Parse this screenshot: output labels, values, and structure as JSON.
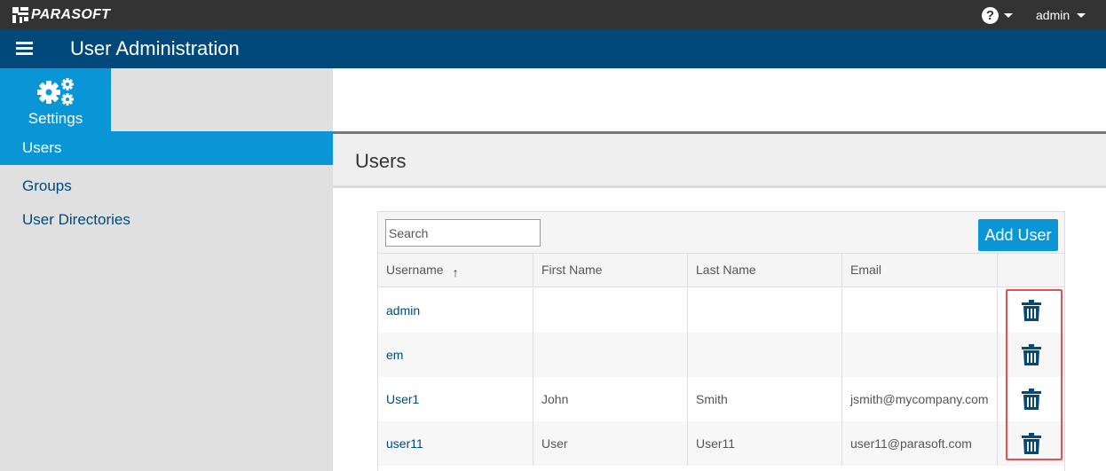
{
  "topbar": {
    "logo_text": "PARASOFT",
    "help_icon": "question-circle-icon",
    "user_name": "admin"
  },
  "titlebar": {
    "menu_icon": "hamburger-icon",
    "title": "User Administration"
  },
  "sidebar": {
    "settings_icon": "gears-icon",
    "settings_label": "Settings",
    "items": [
      {
        "label": "Users",
        "active": true
      },
      {
        "label": "Groups",
        "active": false
      },
      {
        "label": "User Directories",
        "active": false
      }
    ]
  },
  "main": {
    "section_title": "Users",
    "search": {
      "placeholder": "Search",
      "value": ""
    },
    "add_button": "Add User",
    "columns": [
      "Username",
      "First Name",
      "Last Name",
      "Email"
    ],
    "sort": {
      "column": "Username",
      "direction": "ascending",
      "icon": "arrow-up-icon"
    },
    "rows": [
      {
        "username": "admin",
        "first_name": "",
        "last_name": "",
        "email": ""
      },
      {
        "username": "em",
        "first_name": "",
        "last_name": "",
        "email": ""
      },
      {
        "username": "User1",
        "first_name": "John",
        "last_name": "Smith",
        "email": "jsmith@mycompany.com"
      },
      {
        "username": "user11",
        "first_name": "User",
        "last_name": "User11",
        "email": "user11@parasoft.com"
      }
    ],
    "row_action_icon": "trash-icon"
  },
  "colors": {
    "topbar": "#333333",
    "titlebar": "#00497a",
    "accent": "#0a96d6",
    "link": "#00497a",
    "highlight_box": "#e25252"
  }
}
